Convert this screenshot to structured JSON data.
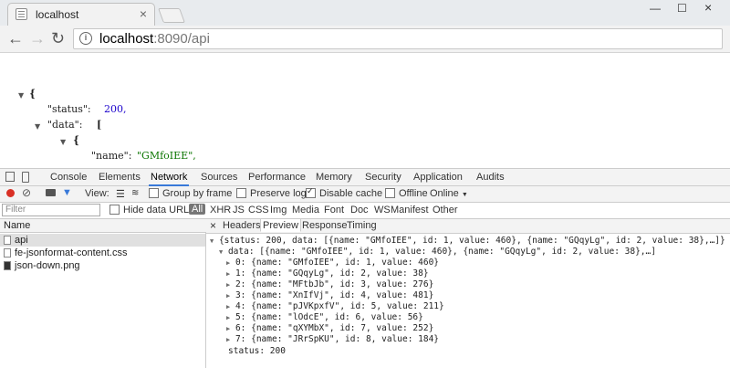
{
  "browser": {
    "tab_title": "localhost",
    "url_host": "localhost",
    "url_rest": ":8090/api"
  },
  "json_view": {
    "lines": [
      "{",
      "\"status\":",
      "200,",
      "\"data\":",
      "[",
      "{",
      "\"name\":",
      "\"GMfoIEE\","
    ]
  },
  "devtools": {
    "tabs": [
      "Console",
      "Elements",
      "Network",
      "Sources",
      "Performance",
      "Memory",
      "Security",
      "Application",
      "Audits"
    ],
    "active_tab": "Network",
    "view_label": "View:",
    "group_by_frame": "Group by frame",
    "preserve_log": "Preserve log",
    "disable_cache": "Disable cache",
    "offline": "Offline",
    "online": "Online",
    "filter_placeholder": "Filter",
    "hide_data_urls": "Hide data URLs",
    "filter_types": [
      "All",
      "XHR",
      "JS",
      "CSS",
      "Img",
      "Media",
      "Font",
      "Doc",
      "WS",
      "Manifest",
      "Other"
    ],
    "name_header": "Name",
    "requests": [
      "api",
      "fe-jsonformat-content.css",
      "json-down.png"
    ],
    "detail_tabs": [
      "Headers",
      "Preview",
      "Response",
      "Timing"
    ],
    "active_detail_tab": "Preview",
    "preview": {
      "root_summary": "{status: 200, data: [{name: \"GMfoIEE\", id: 1, value: 460}, {name: \"GQqyLg\", id: 2, value: 38},…]}",
      "data_summary": "data: [{name: \"GMfoIEE\", id: 1, value: 460}, {name: \"GQqyLg\", id: 2, value: 38},…]",
      "items": [
        "0: {name: \"GMfoIEE\", id: 1, value: 460}",
        "1: {name: \"GQqyLg\", id: 2, value: 38}",
        "2: {name: \"MFtbJb\", id: 3, value: 276}",
        "3: {name: \"XnIfVj\", id: 4, value: 481}",
        "4: {name: \"pJVKpxfV\", id: 5, value: 211}",
        "5: {name: \"lOdcE\", id: 6, value: 56}",
        "6: {name: \"qXYMbX\", id: 7, value: 252}",
        "7: {name: \"JRrSpKU\", id: 8, value: 184}"
      ],
      "status_line": "status: 200"
    }
  }
}
